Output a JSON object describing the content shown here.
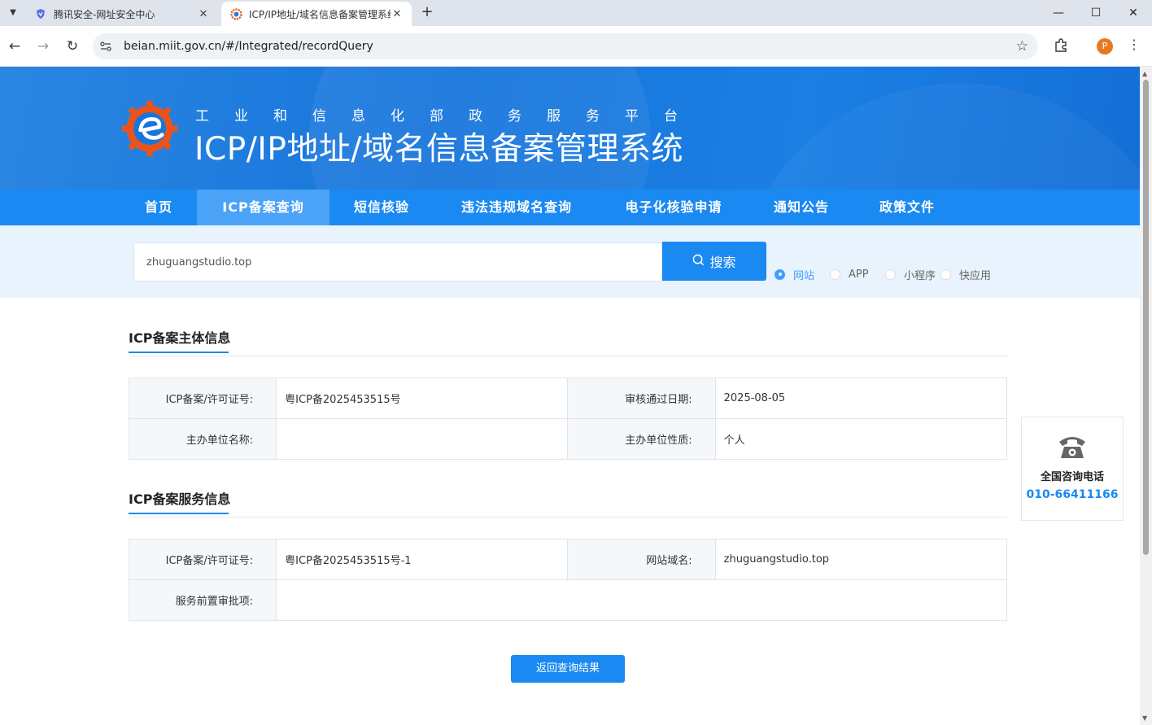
{
  "browser": {
    "tabs": [
      {
        "title": "腾讯安全-网址安全中心",
        "active": false,
        "icon": "shield-icon"
      },
      {
        "title": "ICP/IP地址/域名信息备案管理系统",
        "active": true,
        "icon": "miit-logo-icon"
      }
    ],
    "url": "beian.miit.gov.cn/#/Integrated/recordQuery",
    "profile_initial": "P"
  },
  "header": {
    "subtitle": "工业和信息化部政务服务平台",
    "title": "ICP/IP地址/域名信息备案管理系统"
  },
  "nav": {
    "items": [
      {
        "label": "首页",
        "active": false
      },
      {
        "label": "ICP备案查询",
        "active": true
      },
      {
        "label": "短信核验",
        "active": false
      },
      {
        "label": "违法违规域名查询",
        "active": false
      },
      {
        "label": "电子化核验申请",
        "active": false
      },
      {
        "label": "通知公告",
        "active": false
      },
      {
        "label": "政策文件",
        "active": false
      }
    ]
  },
  "search": {
    "value": "zhuguangstudio.top",
    "button_label": "搜索",
    "types": [
      {
        "label": "网站",
        "checked": true
      },
      {
        "label": "APP",
        "checked": false
      },
      {
        "label": "小程序",
        "checked": false
      },
      {
        "label": "快应用",
        "checked": false
      }
    ]
  },
  "subject_info": {
    "title": "ICP备案主体信息",
    "rows": [
      [
        {
          "key": "ICP备案/许可证号:",
          "value": "粤ICP备2025453515号"
        },
        {
          "key": "审核通过日期:",
          "value": "2025-08-05"
        }
      ],
      [
        {
          "key": "主办单位名称:",
          "value": ""
        },
        {
          "key": "主办单位性质:",
          "value": "个人"
        }
      ]
    ]
  },
  "service_info": {
    "title": "ICP备案服务信息",
    "rows": [
      [
        {
          "key": "ICP备案/许可证号:",
          "value": "粤ICP备2025453515号-1"
        },
        {
          "key": "网站域名:",
          "value": "zhuguangstudio.top"
        }
      ],
      [
        {
          "key": "服务前置审批项:",
          "value": ""
        }
      ]
    ]
  },
  "return_button": "返回查询结果",
  "hotline": {
    "label": "全国咨询电话",
    "number": "010-66411166"
  },
  "colors": {
    "primary": "#1a89f2",
    "nav_active": "#4aa3f7",
    "banner": "#1775dc",
    "search_band": "#e8f3fd"
  }
}
